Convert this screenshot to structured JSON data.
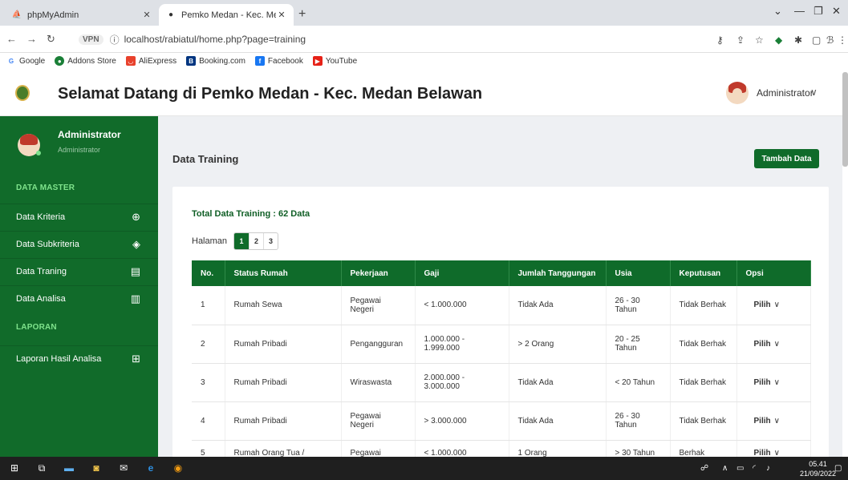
{
  "browser": {
    "tabs": [
      {
        "title": "phpMyAdmin",
        "active": false
      },
      {
        "title": "Pemko Medan - Kec. Medan Bela",
        "active": true
      }
    ],
    "url": "localhost/rabiatul/home.php?page=training",
    "vpn_label": "VPN",
    "bookmarks": [
      "Google",
      "Addons Store",
      "AliExpress",
      "Booking.com",
      "Facebook",
      "YouTube"
    ]
  },
  "header": {
    "title": "Selamat Datang di Pemko Medan - Kec. Medan Belawan",
    "user": "Administrator"
  },
  "sidebar": {
    "user_name": "Administrator",
    "user_role": "Administrator",
    "sections": [
      {
        "title": "DATA MASTER",
        "items": [
          {
            "label": "Data Kriteria",
            "icon": "globe-icon"
          },
          {
            "label": "Data Subkriteria",
            "icon": "layers-icon"
          },
          {
            "label": "Data Traning",
            "icon": "book-icon"
          },
          {
            "label": "Data Analisa",
            "icon": "bar-chart-icon"
          }
        ]
      },
      {
        "title": "LAPORAN",
        "items": [
          {
            "label": "Laporan Hasil Analisa",
            "icon": "grid-icon"
          }
        ]
      }
    ]
  },
  "main": {
    "page_title": "Data Training",
    "add_button": "Tambah Data",
    "total_label": "Total Data Training : 62 Data",
    "halaman_label": "Halaman",
    "pages": [
      "1",
      "2",
      "3"
    ],
    "active_page": "1",
    "table": {
      "columns": [
        "No.",
        "Status Rumah",
        "Pekerjaan",
        "Gaji",
        "Jumlah Tanggungan",
        "Usia",
        "Keputusan",
        "Opsi"
      ],
      "rows": [
        [
          "1",
          "Rumah Sewa",
          "Pegawai Negeri",
          "< 1.000.000",
          "Tidak Ada",
          "26 - 30 Tahun",
          "Tidak Berhak",
          "Pilih"
        ],
        [
          "2",
          "Rumah Pribadi",
          "Pengangguran",
          "1.000.000 - 1.999.000",
          "> 2 Orang",
          "20 - 25 Tahun",
          "Tidak Berhak",
          "Pilih"
        ],
        [
          "3",
          "Rumah Pribadi",
          "Wiraswasta",
          "2.000.000 - 3.000.000",
          "Tidak Ada",
          "< 20 Tahun",
          "Tidak Berhak",
          "Pilih"
        ],
        [
          "4",
          "Rumah Pribadi",
          "Pegawai Negeri",
          "> 3.000.000",
          "Tidak Ada",
          "26 - 30 Tahun",
          "Tidak Berhak",
          "Pilih"
        ],
        [
          "5",
          "Rumah Orang Tua / Saudara",
          "Pegawai Negeri",
          "< 1.000.000",
          "1 Orang",
          "> 30 Tahun",
          "Berhak",
          "Pilih"
        ]
      ]
    }
  },
  "taskbar": {
    "time": "05.41",
    "date": "21/09/2022"
  },
  "colors": {
    "brand_green": "#0f6b2a",
    "sidebar_bg": "#116b2a",
    "section_green": "#7fe38c"
  }
}
